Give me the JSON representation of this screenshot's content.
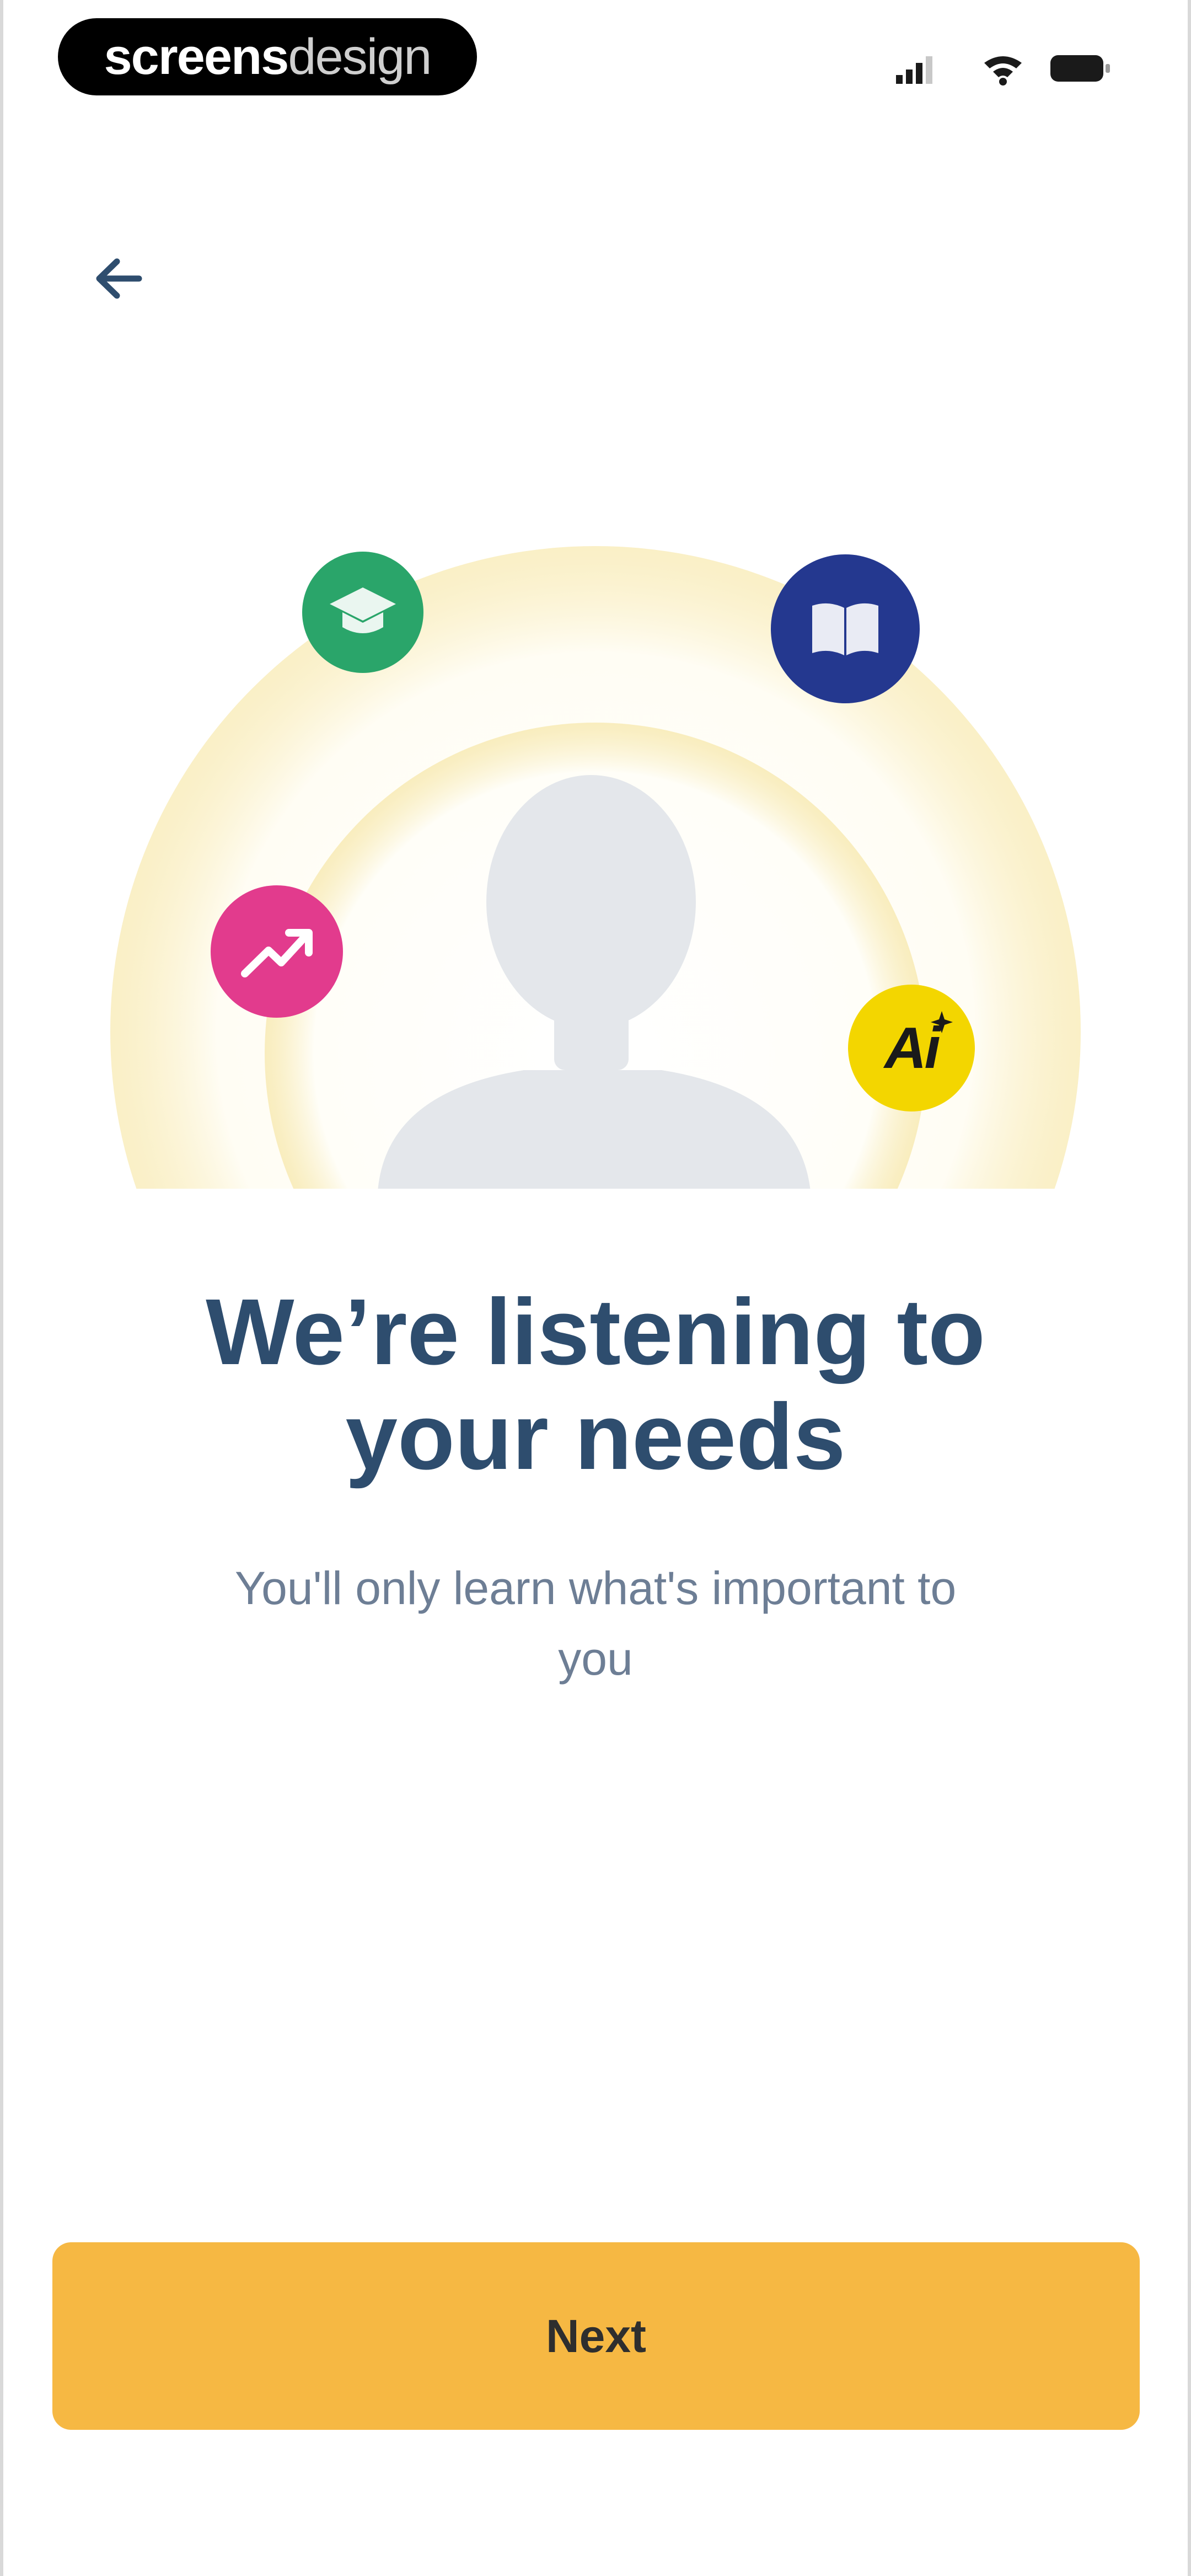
{
  "status_bar": {
    "brand_part1": "screens",
    "brand_part2": "design"
  },
  "navigation": {
    "back_icon": "arrow-left-icon"
  },
  "illustration": {
    "icons": [
      "graduation-cap-icon",
      "book-icon",
      "trending-up-icon",
      "ai-sparkle-icon"
    ],
    "ai_label": "Ai",
    "colors": {
      "cap": "#2aa56a",
      "book": "#24388f",
      "chart": "#e23b8d",
      "ai": "#f3d600",
      "halo": "#f7e7a8",
      "avatar": "#e4e7eb"
    }
  },
  "content": {
    "title_line1": "We’re listening to",
    "title_line2": "your needs",
    "subtitle_line1": "You'll only learn what's important to",
    "subtitle_line2": "you"
  },
  "actions": {
    "next_label": "Next",
    "accent": "#f6b843"
  }
}
